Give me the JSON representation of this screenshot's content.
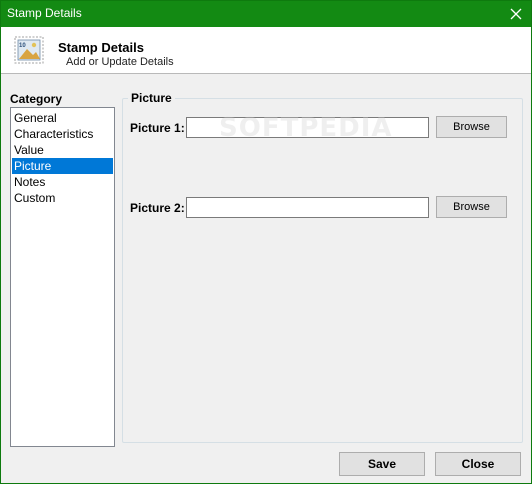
{
  "window": {
    "title": "Stamp Details"
  },
  "header": {
    "title": "Stamp Details",
    "subtitle": "Add or Update Details",
    "icon": "stamp-icon"
  },
  "category": {
    "label": "Category",
    "items": [
      "General",
      "Characteristics",
      "Value",
      "Picture",
      "Notes",
      "Custom"
    ],
    "selected": "Picture"
  },
  "picture_group": {
    "title": "Picture",
    "fields": [
      {
        "label": "Picture 1:",
        "value": "",
        "button": "Browse"
      },
      {
        "label": "Picture 2:",
        "value": "",
        "button": "Browse"
      }
    ]
  },
  "watermark": "SOFTPEDIA",
  "footer": {
    "save_label": "Save",
    "close_label": "Close"
  },
  "colors": {
    "titlebar": "#138a13",
    "selection": "#0078d7"
  }
}
